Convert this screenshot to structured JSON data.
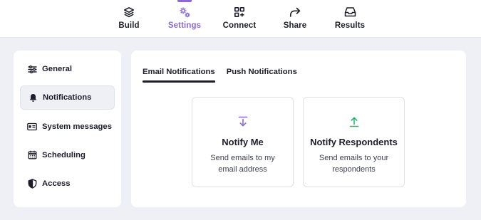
{
  "topnav": {
    "items": [
      {
        "label": "Build",
        "icon": "layers-icon"
      },
      {
        "label": "Settings",
        "icon": "gears-icon",
        "active": true
      },
      {
        "label": "Connect",
        "icon": "grid-plus-icon"
      },
      {
        "label": "Share",
        "icon": "share-arrow-icon"
      },
      {
        "label": "Results",
        "icon": "inbox-icon"
      }
    ],
    "accent_color": "#8c6ad6"
  },
  "sidebar": {
    "items": [
      {
        "label": "General",
        "icon": "sliders-icon"
      },
      {
        "label": "Notifications",
        "icon": "bell-icon",
        "active": true
      },
      {
        "label": "System messages",
        "icon": "id-card-icon"
      },
      {
        "label": "Scheduling",
        "icon": "calendar-icon"
      },
      {
        "label": "Access",
        "icon": "shield-icon"
      }
    ]
  },
  "main": {
    "tabs": [
      {
        "label": "Email Notifications",
        "active": true
      },
      {
        "label": "Push Notifications"
      }
    ],
    "cards": [
      {
        "title": "Notify Me",
        "description": "Send emails to my email address",
        "icon": "download-arrow-icon",
        "icon_color": "#8c6ad6"
      },
      {
        "title": "Notify Respondents",
        "description": "Send emails to your respondents",
        "icon": "upload-arrow-icon",
        "icon_color": "#2bb673"
      }
    ]
  }
}
